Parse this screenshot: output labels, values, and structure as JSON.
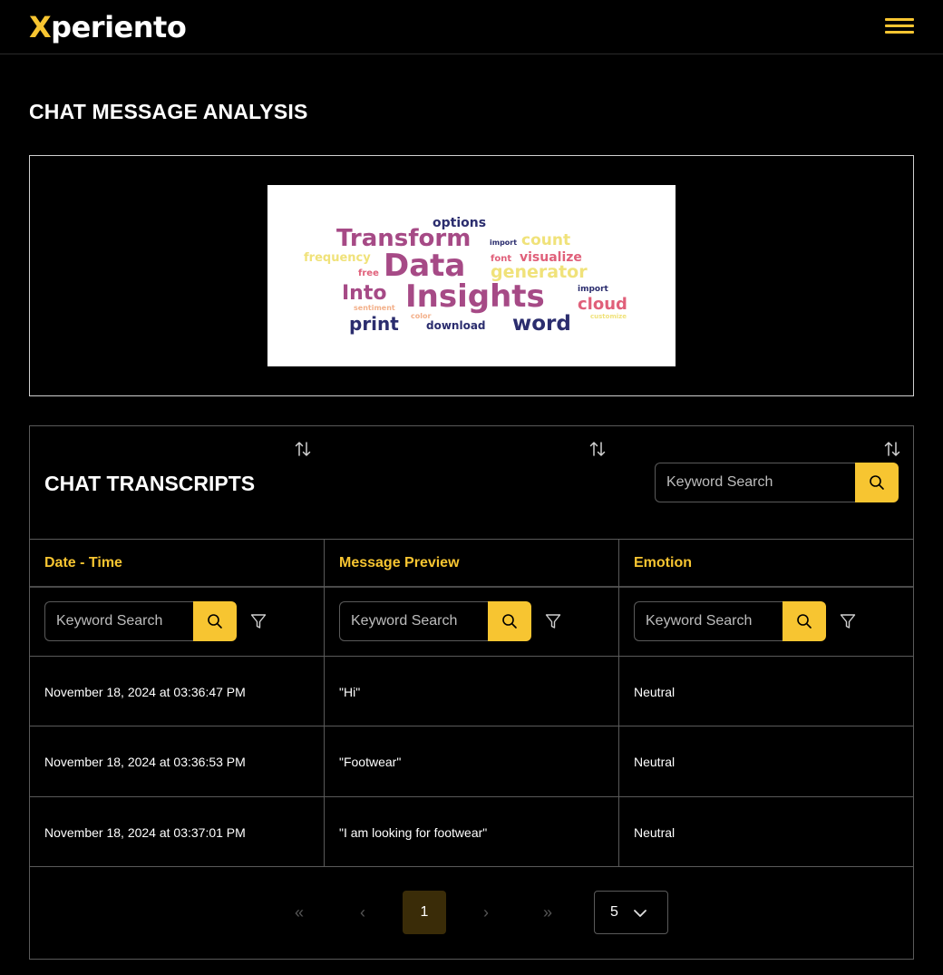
{
  "header": {
    "brand_first": "X",
    "brand_rest": "periento",
    "menu_icon": "hamburger-menu-icon"
  },
  "analysis": {
    "title": "CHAT MESSAGE ANALYSIS",
    "word_cloud": [
      {
        "text": "options",
        "color": "#2b2d6e"
      },
      {
        "text": "Transform",
        "color": "#a64a86"
      },
      {
        "text": "import",
        "color": "#2b2d6e"
      },
      {
        "text": "count",
        "color": "#f0e27a"
      },
      {
        "text": "frequency",
        "color": "#f0e27a"
      },
      {
        "text": "Data",
        "color": "#a64a86"
      },
      {
        "text": "font",
        "color": "#e0607a"
      },
      {
        "text": "visualize",
        "color": "#e0607a"
      },
      {
        "text": "free",
        "color": "#e0607a"
      },
      {
        "text": "generator",
        "color": "#f0e27a"
      },
      {
        "text": "Into",
        "color": "#a64a86"
      },
      {
        "text": "Insights",
        "color": "#a64a86"
      },
      {
        "text": "import",
        "color": "#2b2d6e"
      },
      {
        "text": "cloud",
        "color": "#e0607a"
      },
      {
        "text": "sentiment",
        "color": "#f3b08a"
      },
      {
        "text": "color",
        "color": "#f3b08a"
      },
      {
        "text": "print",
        "color": "#2b2d6e"
      },
      {
        "text": "download",
        "color": "#2b2d6e"
      },
      {
        "text": "word",
        "color": "#2b2d6e"
      },
      {
        "text": "customize",
        "color": "#f0e27a"
      }
    ]
  },
  "transcripts": {
    "title": "CHAT TRANSCRIPTS",
    "global_search_placeholder": "Keyword Search",
    "columns": [
      {
        "label": "Date - Time",
        "filter_placeholder": "Keyword Search"
      },
      {
        "label": "Message Preview",
        "filter_placeholder": "Keyword Search"
      },
      {
        "label": "Emotion",
        "filter_placeholder": "Keyword Search"
      }
    ],
    "rows": [
      {
        "datetime": "November 18, 2024 at 03:36:47 PM",
        "message": "\"Hi\"",
        "emotion": "Neutral"
      },
      {
        "datetime": "November 18, 2024 at 03:36:53 PM",
        "message": "\"Footwear\"",
        "emotion": "Neutral"
      },
      {
        "datetime": "November 18, 2024 at 03:37:01 PM",
        "message": "\"I am looking for footwear\"",
        "emotion": "Neutral"
      }
    ],
    "pagination": {
      "first": "«",
      "prev": "‹",
      "current_page": "1",
      "next": "›",
      "last": "»",
      "rows_per_page": "5"
    }
  },
  "colors": {
    "accent": "#f7c531",
    "background": "#000000",
    "border": "#5a5a5a"
  }
}
